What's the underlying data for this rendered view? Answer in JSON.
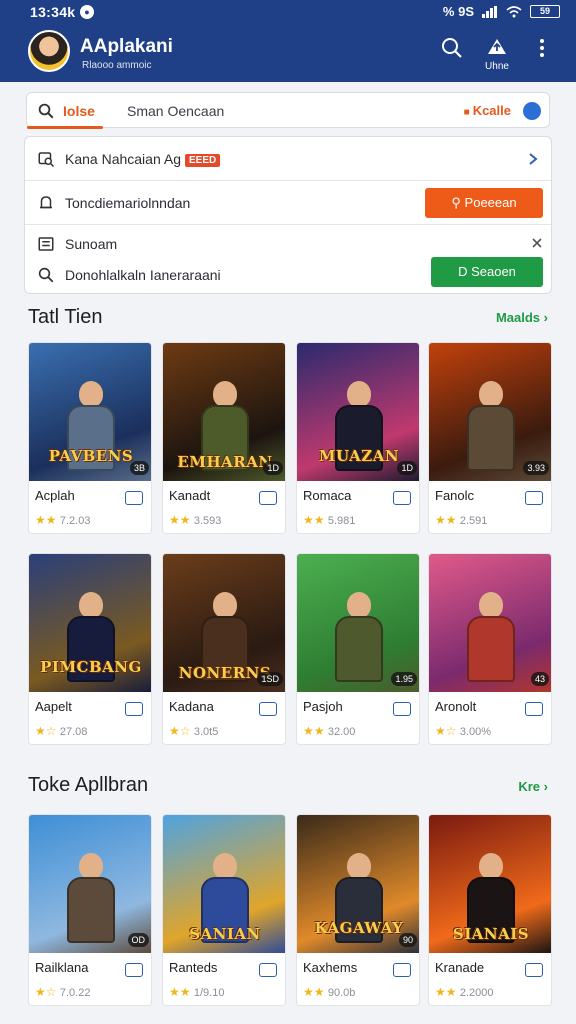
{
  "status": {
    "time": "13:34k",
    "right_text": "% 9S",
    "battery": "59"
  },
  "header": {
    "title": "AAplakani",
    "subtitle": "Rlaooo ammoic",
    "menu_label": "Uhne",
    "icons": [
      "search-icon",
      "upload-icon",
      "more-vertical-icon"
    ]
  },
  "search": {
    "prefix": "Iolse",
    "text": "Sman Oencaan",
    "right_label": "Kcalle"
  },
  "filters": {
    "row1": {
      "label": "Kana Nahcaian Ag",
      "badge": "EEED"
    },
    "row2": {
      "label": "Toncdiemariolnndan",
      "button": "Poeeean"
    },
    "row3": {
      "label_a": "Sunoam",
      "label_b": "Donohlalkaln Ianeraraani",
      "button": "D Seaoen"
    }
  },
  "colors": {
    "header": "#1f3f86",
    "accent_orange": "#ee5b18",
    "accent_green": "#1f9a45",
    "star": "#f0b71c"
  },
  "section1": {
    "title": "Tatl Tien",
    "more": "Maalds",
    "cards": [
      {
        "art_title": "PAVBENS",
        "name": "Acplah",
        "rating": "7.2.03",
        "badge": "3B",
        "stars": 2
      },
      {
        "art_title": "EMHARAN",
        "name": "Kanadt",
        "rating": "3.593",
        "badge": "1D",
        "stars": 2
      },
      {
        "art_title": "MUAZAN",
        "name": "Romaca",
        "rating": "5.981",
        "badge": "1D",
        "stars": 2
      },
      {
        "art_title": "",
        "name": "Fanolc",
        "rating": "2.591",
        "badge": "3.93",
        "stars": 2
      }
    ]
  },
  "section2": {
    "cards": [
      {
        "art_title": "PIMCBANG",
        "name": "Aapelt",
        "rating": "27.08",
        "badge": "",
        "stars": 1
      },
      {
        "art_title": "NONERNS",
        "name": "Kadana",
        "rating": "3.0t5",
        "badge": "1SD",
        "stars": 1
      },
      {
        "art_title": "",
        "name": "Pasjoh",
        "rating": "32.00",
        "badge": "1.95",
        "stars": 2
      },
      {
        "art_title": "",
        "name": "Aronolt",
        "rating": "3.00%",
        "badge": "43",
        "stars": 1
      }
    ]
  },
  "section3": {
    "title": "Toke Apllbran",
    "more": "Kre",
    "cards": [
      {
        "art_title": "",
        "name": "Railklana",
        "rating": "7.0.22",
        "badge": "OD",
        "stars": 1
      },
      {
        "art_title": "SANIAN",
        "name": "Ranteds",
        "rating": "1/9.10",
        "badge": "",
        "stars": 2
      },
      {
        "art_title": "KAGAWAY",
        "name": "Kaxhems",
        "rating": "90.0b",
        "badge": "90",
        "stars": 2
      },
      {
        "art_title": "SIANAIS",
        "name": "Kranade",
        "rating": "2.2000",
        "badge": "",
        "stars": 2
      }
    ]
  }
}
